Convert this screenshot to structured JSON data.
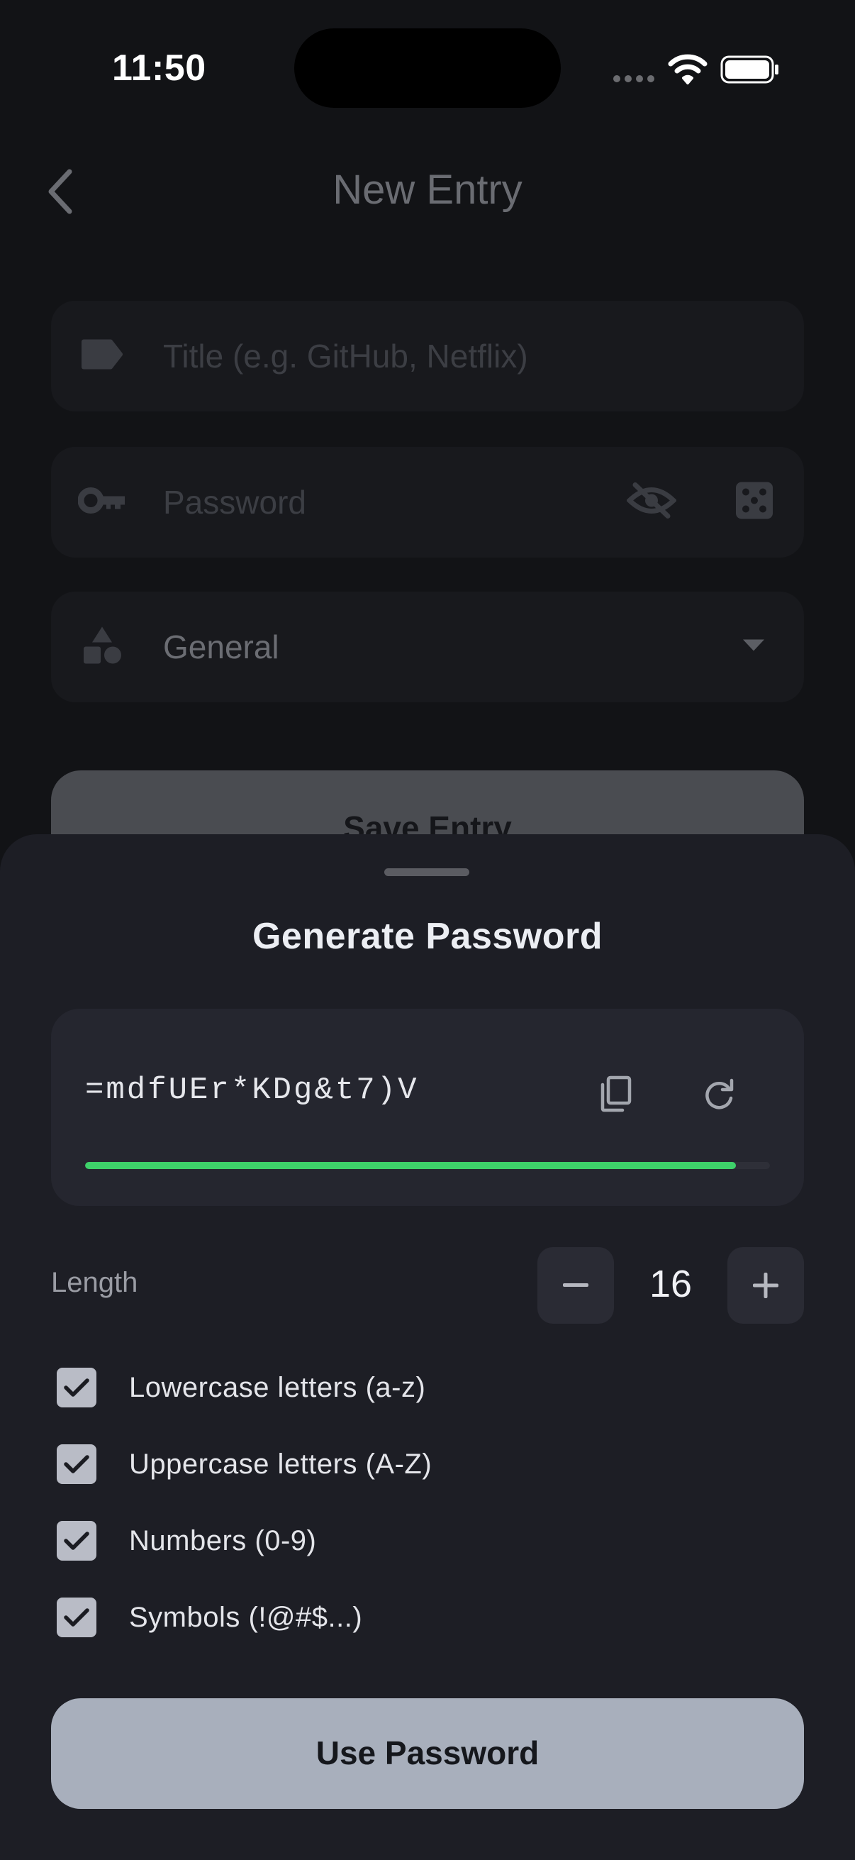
{
  "status_bar": {
    "time": "11:50"
  },
  "header": {
    "title": "New Entry"
  },
  "form": {
    "title_placeholder": "Title (e.g. GitHub, Netflix)",
    "password_placeholder": "Password",
    "category_value": "General",
    "save_label": "Save Entry"
  },
  "generator": {
    "title": "Generate Password",
    "password": "=mdfUEr*KDg&t7)V",
    "strength_fraction": 0.95,
    "strength_color": "#3ed16a",
    "length_label": "Length",
    "length_value": "16",
    "options": [
      {
        "label": "Lowercase letters (a-z)",
        "checked": true
      },
      {
        "label": "Uppercase letters (A-Z)",
        "checked": true
      },
      {
        "label": "Numbers (0-9)",
        "checked": true
      },
      {
        "label": "Symbols (!@#$...)",
        "checked": true
      }
    ],
    "use_label": "Use Password"
  }
}
